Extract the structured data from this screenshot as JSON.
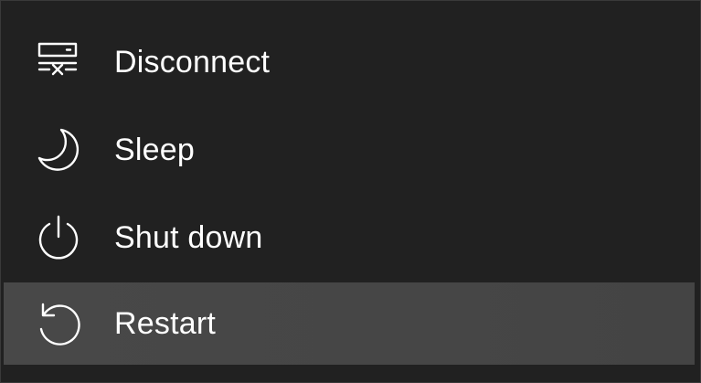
{
  "power_menu": {
    "items": [
      {
        "label": "Disconnect",
        "icon": "disconnect-icon"
      },
      {
        "label": "Sleep",
        "icon": "moon-icon"
      },
      {
        "label": "Shut down",
        "icon": "power-icon"
      },
      {
        "label": "Restart",
        "icon": "restart-icon",
        "highlighted": true
      }
    ]
  },
  "colors": {
    "background": "#212121",
    "highlight": "#464646",
    "text": "#ffffff"
  }
}
